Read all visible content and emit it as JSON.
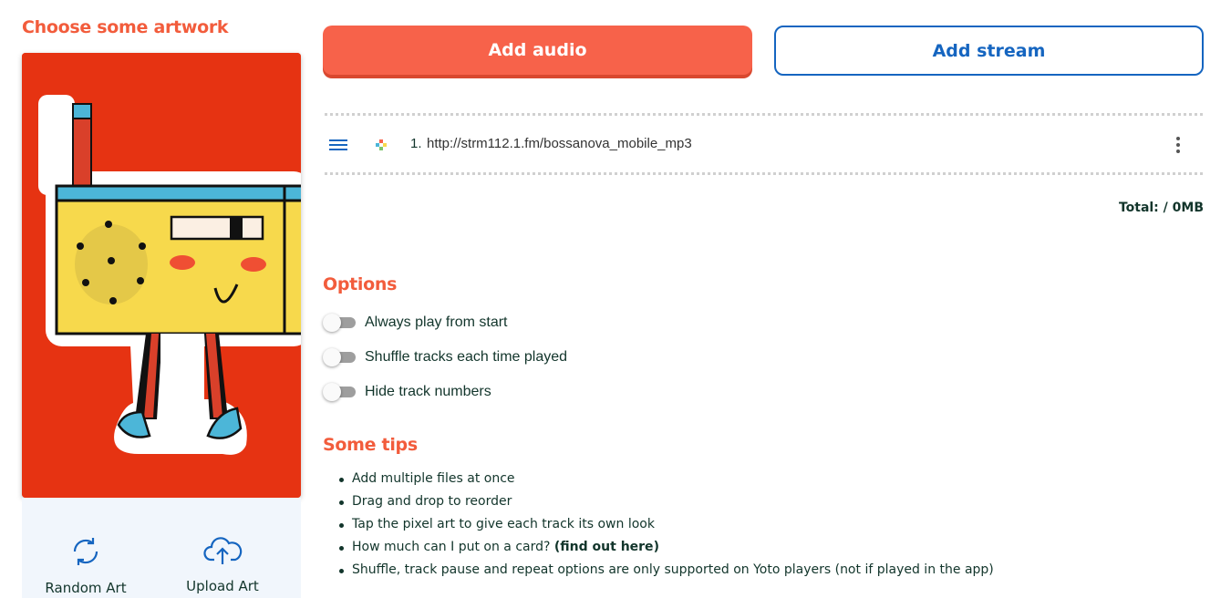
{
  "artwork": {
    "heading": "Choose some artwork",
    "random_label": "Random Art",
    "upload_label": "Upload Art"
  },
  "actions": {
    "add_audio": "Add audio",
    "add_stream": "Add stream"
  },
  "tracks": [
    {
      "number": "1.",
      "title": "http://strm112.1.fm/bossanova_mobile_mp3"
    }
  ],
  "total": "Total: / 0MB",
  "options": {
    "heading": "Options",
    "items": [
      {
        "label": "Always play from start",
        "enabled": false
      },
      {
        "label": "Shuffle tracks each time played",
        "enabled": false
      },
      {
        "label": "Hide track numbers",
        "enabled": false
      }
    ]
  },
  "tips": {
    "heading": "Some tips",
    "items": [
      "Add multiple files at once",
      "Drag and drop to reorder",
      "Tap the pixel art to give each track its own look"
    ],
    "card_question": "How much can I put on a card?",
    "card_link_text": "find out here",
    "last": "Shuffle, track pause and repeat options are only supported on Yoto players (not if played in the app)"
  },
  "colors": {
    "accent": "#f25c3c",
    "blue": "#1565c0",
    "text": "#12352b",
    "art_background": "#e63312"
  },
  "icons": {
    "random": "refresh-icon",
    "upload": "cloud-upload-icon",
    "drag": "drag-handle-icon",
    "pixel": "pixel-art-icon",
    "menu": "more-vertical-icon"
  }
}
